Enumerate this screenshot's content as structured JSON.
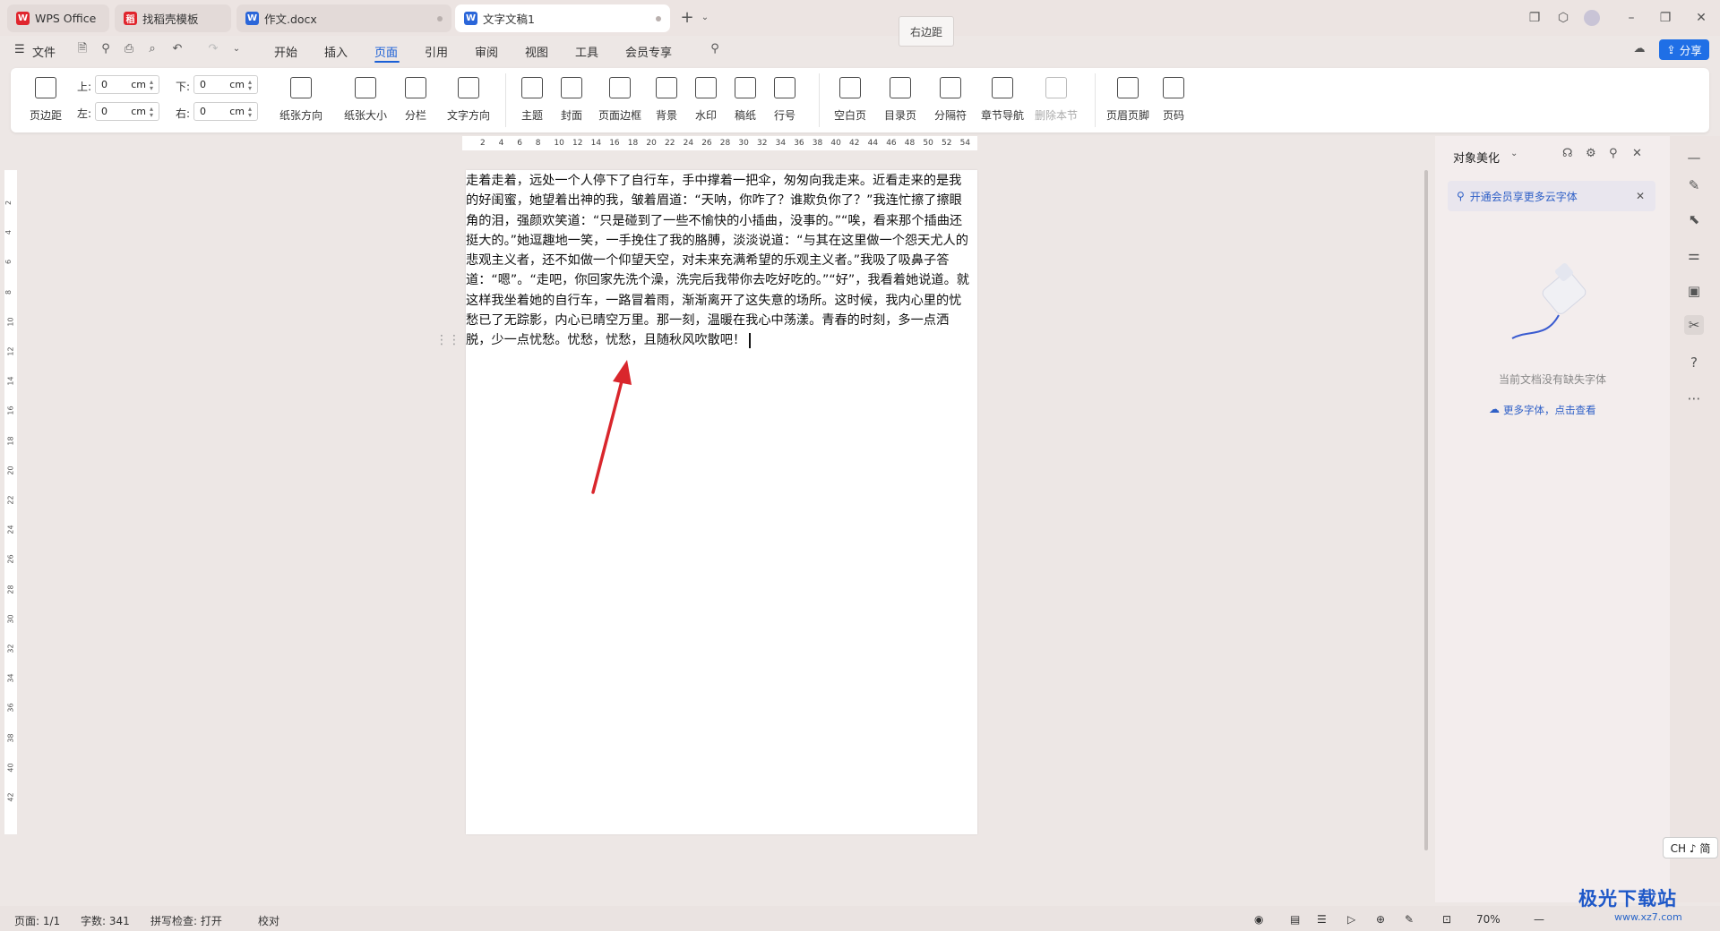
{
  "tabs": [
    {
      "label": "WPS Office"
    },
    {
      "label": "找稻壳模板"
    },
    {
      "label": "作文.docx"
    },
    {
      "label": "文字文稿1"
    }
  ],
  "tooltip": "右边距",
  "menu": {
    "file": "文件",
    "items": [
      "开始",
      "插入",
      "页面",
      "引用",
      "审阅",
      "视图",
      "工具",
      "会员专享"
    ],
    "active": "页面",
    "share": "分享"
  },
  "ribbon": {
    "margin_btn": "页边距",
    "margins": {
      "top_label": "上:",
      "top_value": "0",
      "bottom_label": "下:",
      "bottom_value": "0",
      "left_label": "左:",
      "left_value": "0",
      "right_label": "右:",
      "right_value": "0",
      "unit": "cm"
    },
    "buttons": [
      "纸张方向",
      "纸张大小",
      "分栏",
      "文字方向",
      "主题",
      "封面",
      "页面边框",
      "背景",
      "水印",
      "稿纸",
      "行号",
      "空白页",
      "目录页",
      "分隔符",
      "章节导航",
      "删除本节",
      "页眉页脚",
      "页码"
    ]
  },
  "ruler": {
    "top_ticks": [
      "2",
      "4",
      "6",
      "8",
      "10",
      "12",
      "14",
      "16",
      "18",
      "20",
      "22",
      "24",
      "26",
      "28",
      "30",
      "32",
      "34",
      "36",
      "38",
      "40",
      "42",
      "44",
      "46",
      "48",
      "50",
      "52",
      "54"
    ],
    "left_ticks": [
      "2",
      "4",
      "6",
      "8",
      "10",
      "12",
      "14",
      "16",
      "18",
      "20",
      "22",
      "24",
      "26",
      "28",
      "30",
      "32",
      "34",
      "36",
      "38",
      "40",
      "42"
    ]
  },
  "document": {
    "text": "走着走着，远处一个人停下了自行车，手中撑着一把伞，匆匆向我走来。近看走来的是我的好闺蜜，她望着出神的我，皱着眉道：“天呐，你咋了？谁欺负你了？”我连忙擦了擦眼角的泪，强颜欢笑道：“只是碰到了一些不愉快的小插曲，没事的。”“唉，看来那个插曲还挺大的。”她逗趣地一笑，一手挽住了我的胳膊，淡淡说道：“与其在这里做一个怨天尤人的悲观主义者，还不如做一个仰望天空，对未来充满希望的乐观主义者。”我吸了吸鼻子答道：“嗯”。“走吧，你回家先洗个澡，洗完后我带你去吃好吃的。”“好”，我看着她说道。就这样我坐着她的自行车，一路冒着雨，渐渐离开了这失意的场所。这时候，我内心里的忧愁已了无踪影，内心已晴空万里。那一刻，温暖在我心中荡漾。青春的时刻，多一点洒脱，少一点忧愁。忧愁，忧愁，且随秋风吹散吧！"
  },
  "panel": {
    "title": "对象美化",
    "promo": "开通会员享更多云字体",
    "empty": "当前文档没有缺失字体",
    "more_link": "更多字体，点击查看"
  },
  "status": {
    "page": "页面: 1/1",
    "words": "字数: 341",
    "spell": "拼写检查: 打开",
    "proof": "校对",
    "zoom": "70%"
  },
  "ime": "CH ♪ 简",
  "watermark": {
    "title": "极光下载站",
    "url": "www.xz7.com"
  },
  "colors": {
    "accent": "#1a5fd6",
    "share_bg": "#1f6fe6",
    "arrow": "#d9262c"
  }
}
